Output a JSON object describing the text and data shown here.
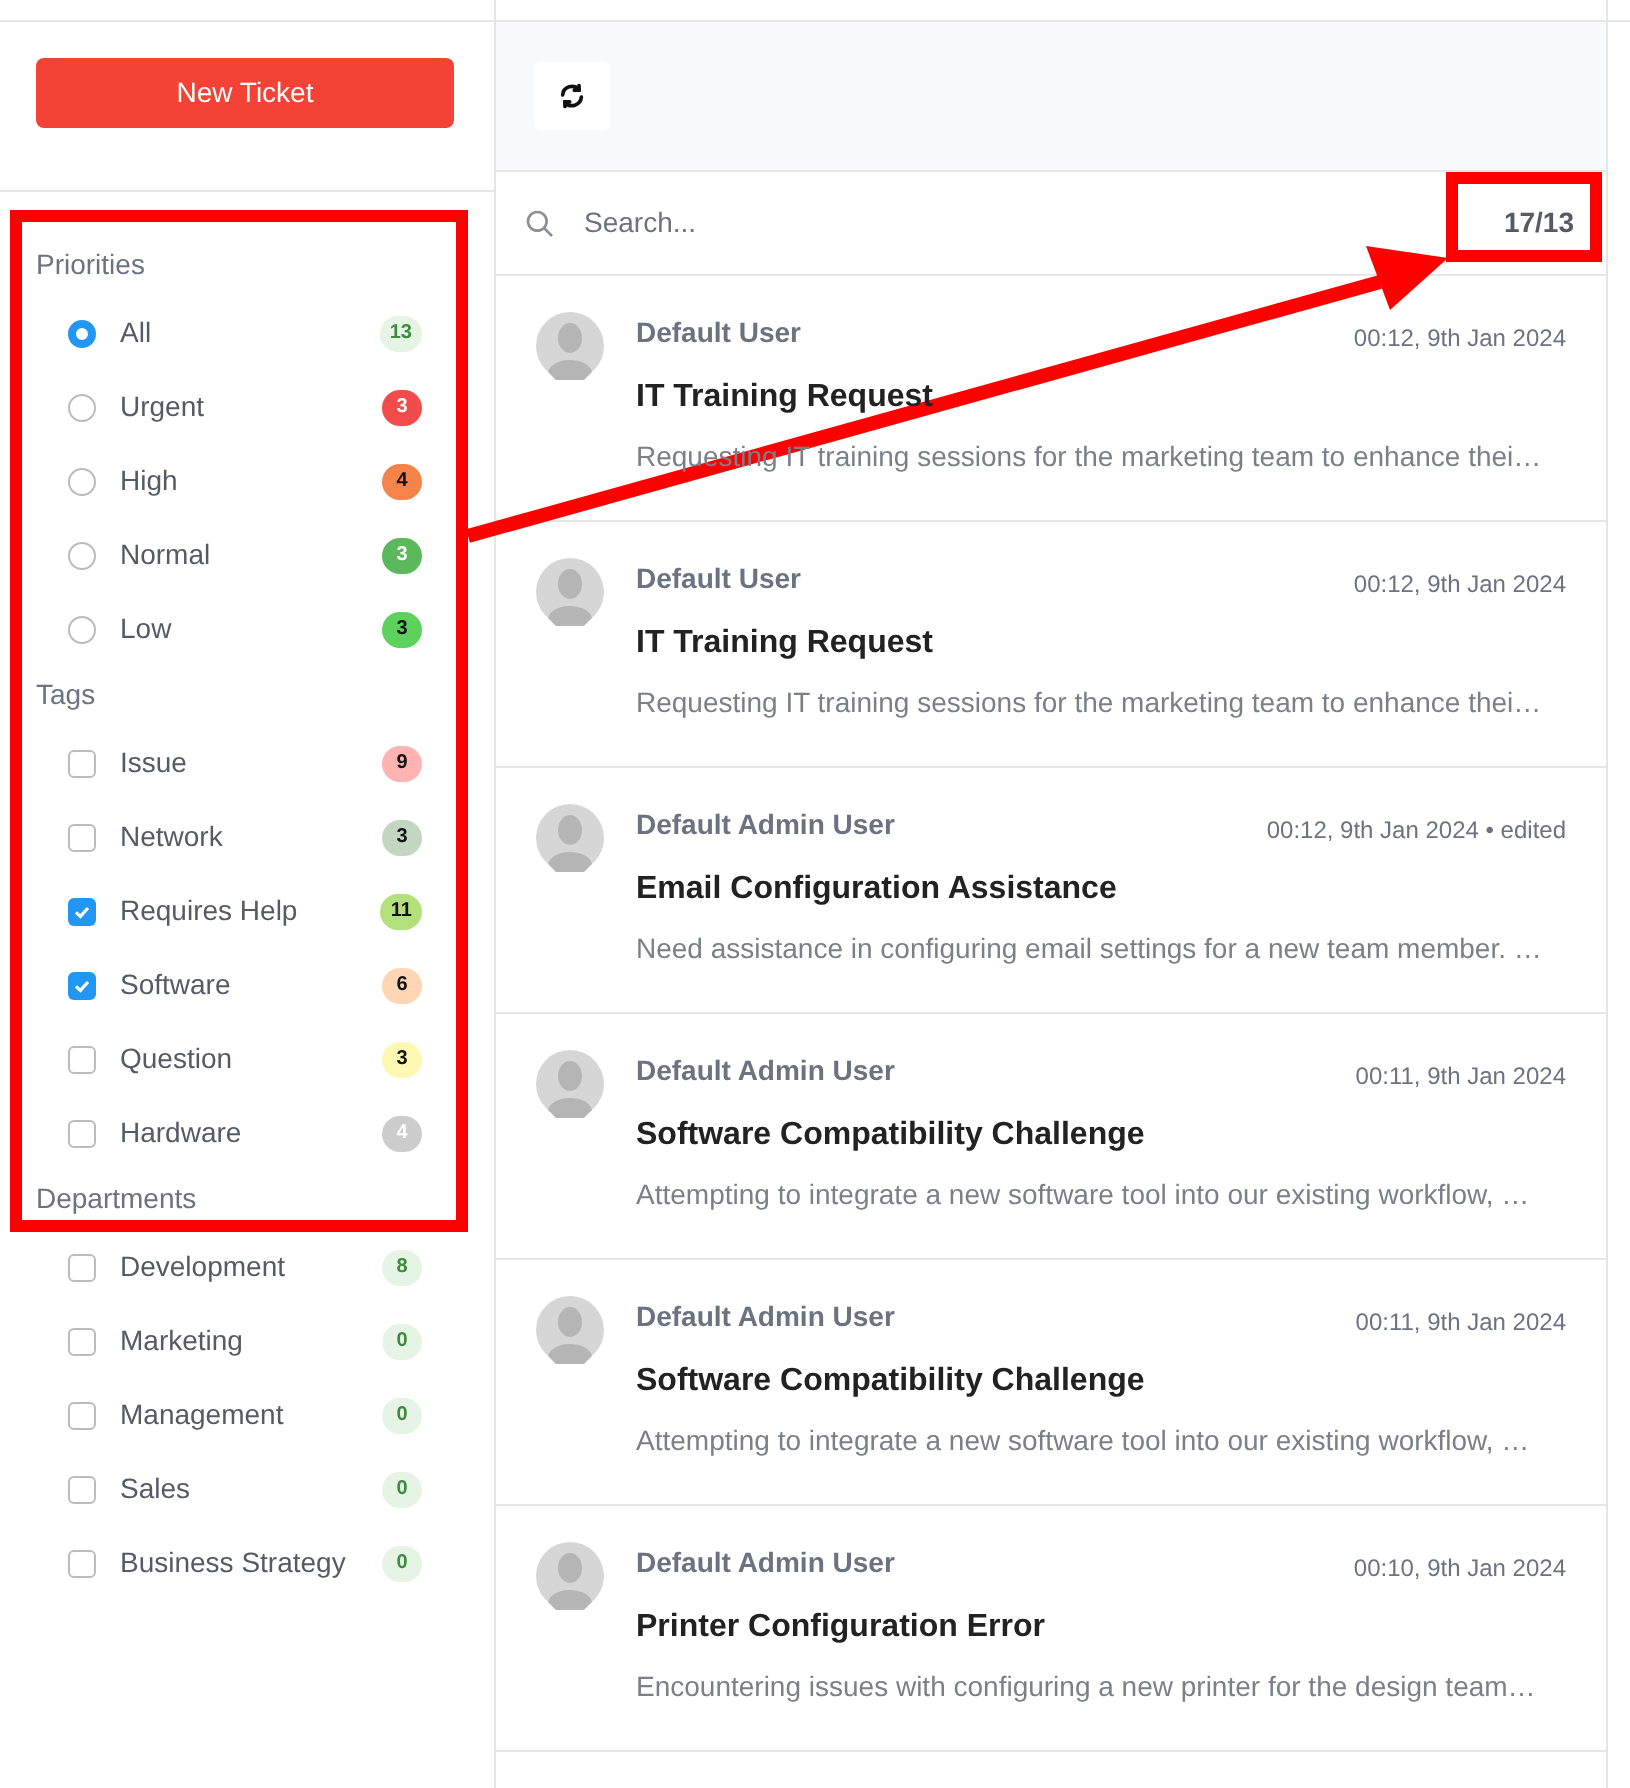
{
  "new_ticket_button": "New Ticket",
  "sidebar": {
    "sections": [
      {
        "title": "Priorities",
        "kind": "radio",
        "items": [
          {
            "label": "All",
            "selected": true,
            "count": "13",
            "color": "#e6f4e6"
          },
          {
            "label": "Urgent",
            "selected": false,
            "count": "3",
            "color": "#f24b4b"
          },
          {
            "label": "High",
            "selected": false,
            "count": "4",
            "color": "#f5834a"
          },
          {
            "label": "Normal",
            "selected": false,
            "count": "3",
            "color": "#5cb85c"
          },
          {
            "label": "Low",
            "selected": false,
            "count": "3",
            "color": "#5cd15c"
          }
        ]
      },
      {
        "title": "Tags",
        "kind": "checkbox",
        "items": [
          {
            "label": "Issue",
            "checked": false,
            "count": "9",
            "color": "#ffb3b3"
          },
          {
            "label": "Network",
            "checked": false,
            "count": "3",
            "color": "#c2d6c2"
          },
          {
            "label": "Requires Help",
            "checked": true,
            "count": "11",
            "color": "#b3e07a"
          },
          {
            "label": "Software",
            "checked": true,
            "count": "6",
            "color": "#ffd6b3"
          },
          {
            "label": "Question",
            "checked": false,
            "count": "3",
            "color": "#fff8b3"
          },
          {
            "label": "Hardware",
            "checked": false,
            "count": "4",
            "color": "#cccccc"
          }
        ]
      },
      {
        "title": "Departments",
        "kind": "checkbox",
        "items": [
          {
            "label": "Development",
            "checked": false,
            "count": "8",
            "color": "#e6f4e6"
          },
          {
            "label": "Marketing",
            "checked": false,
            "count": "0",
            "color": "#e6f4e6"
          },
          {
            "label": "Management",
            "checked": false,
            "count": "0",
            "color": "#e6f4e6"
          },
          {
            "label": "Sales",
            "checked": false,
            "count": "0",
            "color": "#e6f4e6"
          },
          {
            "label": "Business Strategy",
            "checked": false,
            "count": "0",
            "color": "#e6f4e6"
          }
        ]
      }
    ]
  },
  "search": {
    "placeholder": "Search...",
    "count": "17/13"
  },
  "tickets": [
    {
      "author": "Default User",
      "time": "00:12, 9th Jan 2024",
      "title": "IT Training Request",
      "preview": "Requesting IT training sessions for the marketing team to enhance thei…"
    },
    {
      "author": "Default User",
      "time": "00:12, 9th Jan 2024",
      "title": "IT Training Request",
      "preview": "Requesting IT training sessions for the marketing team to enhance thei…"
    },
    {
      "author": "Default Admin User",
      "time": "00:12, 9th Jan 2024 • edited",
      "title": "Email Configuration Assistance",
      "preview": "Need assistance in configuring email settings for a new team member. …"
    },
    {
      "author": "Default Admin User",
      "time": "00:11, 9th Jan 2024",
      "title": "Software Compatibility Challenge",
      "preview": "Attempting to integrate a new software tool into our existing workflow, …"
    },
    {
      "author": "Default Admin User",
      "time": "00:11, 9th Jan 2024",
      "title": "Software Compatibility Challenge",
      "preview": "Attempting to integrate a new software tool into our existing workflow, …"
    },
    {
      "author": "Default Admin User",
      "time": "00:10, 9th Jan 2024",
      "title": "Printer Configuration Error",
      "preview": "Encountering issues with configuring a new printer for the design team…"
    }
  ],
  "annotations": {
    "highlight_boxes": true,
    "arrow": true
  }
}
